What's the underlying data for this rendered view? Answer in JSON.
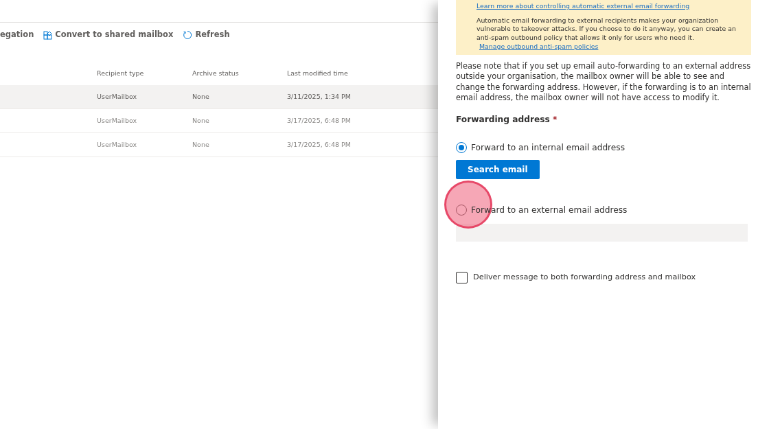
{
  "toolbar": {
    "items": [
      {
        "label": "egation",
        "kind": "plain"
      },
      {
        "label": "Convert to shared mailbox",
        "kind": "convert"
      },
      {
        "label": "Refresh",
        "kind": "refresh"
      }
    ]
  },
  "table": {
    "columns": [
      "Recipient type",
      "Archive status",
      "Last modified time"
    ],
    "rows": [
      {
        "cells": [
          "UserMailbox",
          "None",
          "3/11/2025, 1:34 PM"
        ],
        "selected": true
      },
      {
        "cells": [
          "UserMailbox",
          "None",
          "3/17/2025, 6:48 PM"
        ],
        "selected": false
      },
      {
        "cells": [
          "UserMailbox",
          "None",
          "3/17/2025, 6:48 PM"
        ],
        "selected": false
      }
    ]
  },
  "panel": {
    "warning": {
      "link": "Learn more about controlling automatic external email forwarding",
      "text": "Automatic email forwarding to external recipients makes your organization vulnerable to takeover attacks. If you choose to do it anyway, you can create an anti-spam outbound policy that allows it only for users who need it.",
      "policy_link": "Manage outbound anti-spam policies"
    },
    "note": "Please note that if you set up email auto-forwarding to an external address outside your organisation, the mailbox owner will be able to see and change the forwarding address. However, if the forwarding is to an internal email address, the mailbox owner will not have access to modify it.",
    "forwarding_label": "Forwarding address",
    "required_mark": "*",
    "options": [
      {
        "label": "Forward to an internal email address",
        "selected": true,
        "highlighted": false,
        "kind": "button",
        "button": "Search email"
      },
      {
        "label": "Forward to an external email address",
        "selected": false,
        "highlighted": true,
        "kind": "field"
      }
    ],
    "deliver_both": {
      "label": "Deliver message to both forwarding address and mailbox",
      "checked": false
    }
  }
}
